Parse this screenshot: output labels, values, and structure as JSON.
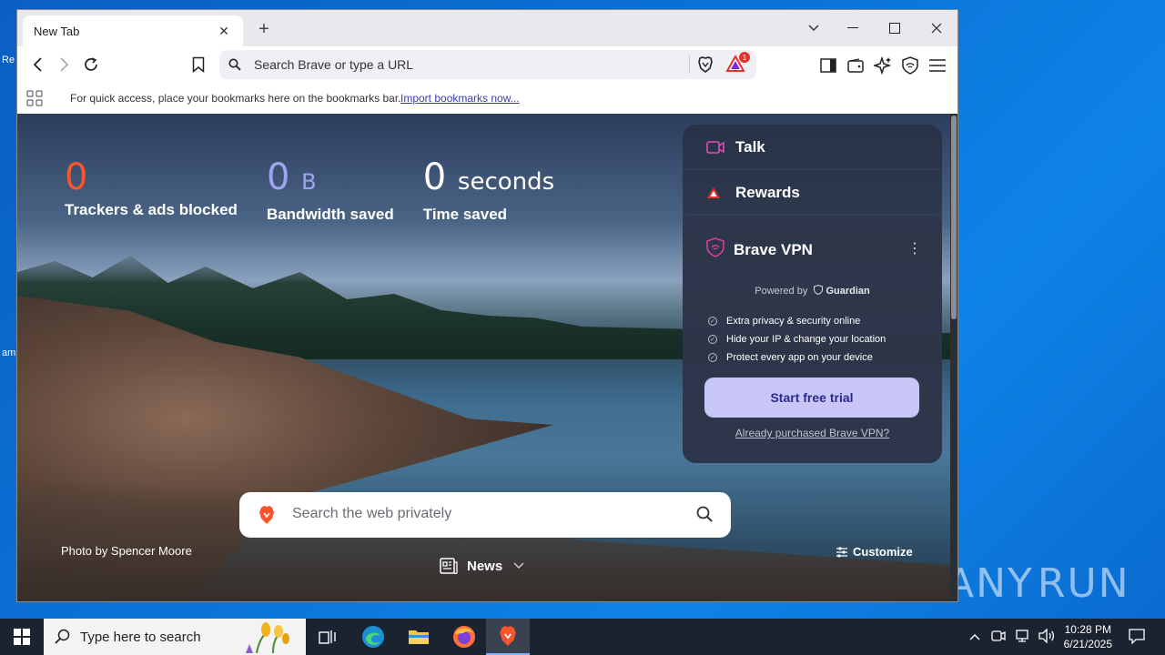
{
  "desktop": {
    "edge_labels": [
      "Re",
      "am"
    ]
  },
  "watermark": {
    "left": "ANY",
    "right": "RUN"
  },
  "browser": {
    "tab": {
      "title": "New Tab",
      "close": "✕"
    },
    "new_tab": "+",
    "window_controls": {
      "dropdown": "⌄",
      "minimize": "—",
      "maximize": "☐",
      "close": "✕"
    },
    "omnibox": {
      "placeholder": "Search Brave or type a URL",
      "rewards_badge": "1"
    },
    "bookmarks_bar": {
      "message": "For quick access, place your bookmarks here on the bookmarks bar.",
      "import_link": "Import bookmarks now..."
    }
  },
  "ntp": {
    "stats": {
      "trackers": {
        "value": "0",
        "label": "Trackers & ads blocked"
      },
      "bandwidth": {
        "value": "0",
        "unit": "B",
        "label": "Bandwidth saved"
      },
      "time": {
        "value": "0",
        "unit": "seconds",
        "label": "Time saved"
      }
    },
    "widget": {
      "talk": "Talk",
      "rewards": "Rewards",
      "vpn": {
        "title": "Brave VPN",
        "powered_by": "Powered by",
        "partner": "Guardian",
        "features": [
          "Extra privacy & security online",
          "Hide your IP & change your location",
          "Protect every app on your device"
        ],
        "cta": "Start free trial",
        "purchased_link": "Already purchased Brave VPN?"
      }
    },
    "search_placeholder": "Search the web privately",
    "photo_credit": "Photo by Spencer Moore",
    "news": "News",
    "customize": "Customize"
  },
  "taskbar": {
    "search_placeholder": "Type here to search",
    "time": "10:28 PM",
    "date": "6/21/2025"
  },
  "colors": {
    "trackers": "#fb542b",
    "bandwidth": "#a0a5eb",
    "vpn_button": "#c8c6f7",
    "brave_orange": "#fb542b"
  }
}
